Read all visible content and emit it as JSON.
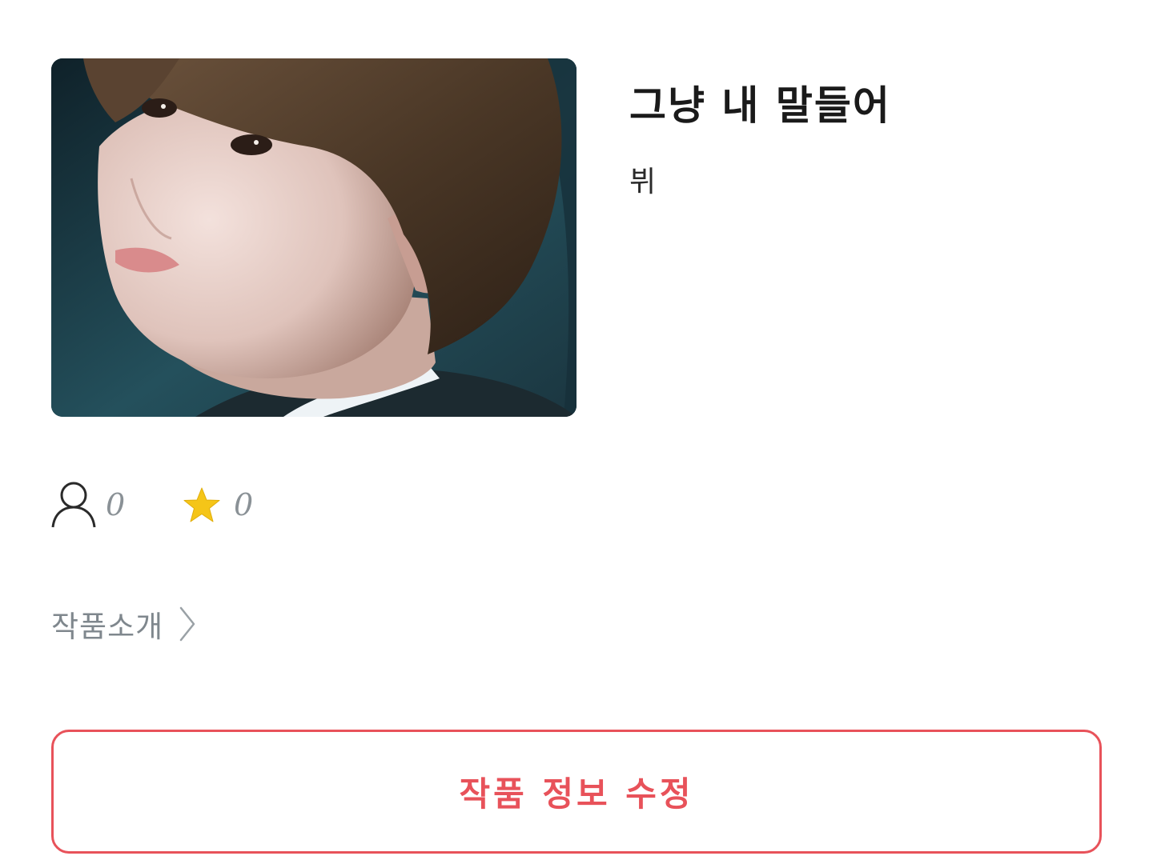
{
  "work": {
    "title": "그냥 내 말들어",
    "author": "뷔"
  },
  "cover": {
    "icon": "cover-photo"
  },
  "stats": {
    "views": {
      "icon": "person-icon",
      "value": "0"
    },
    "stars": {
      "icon": "star-icon",
      "value": "0",
      "color": "#F5C518"
    }
  },
  "intro": {
    "label": "작품소개",
    "icon": "chevron-right-icon"
  },
  "edit_button": {
    "label": "작품 정보 수정",
    "color": "#E8525A"
  }
}
